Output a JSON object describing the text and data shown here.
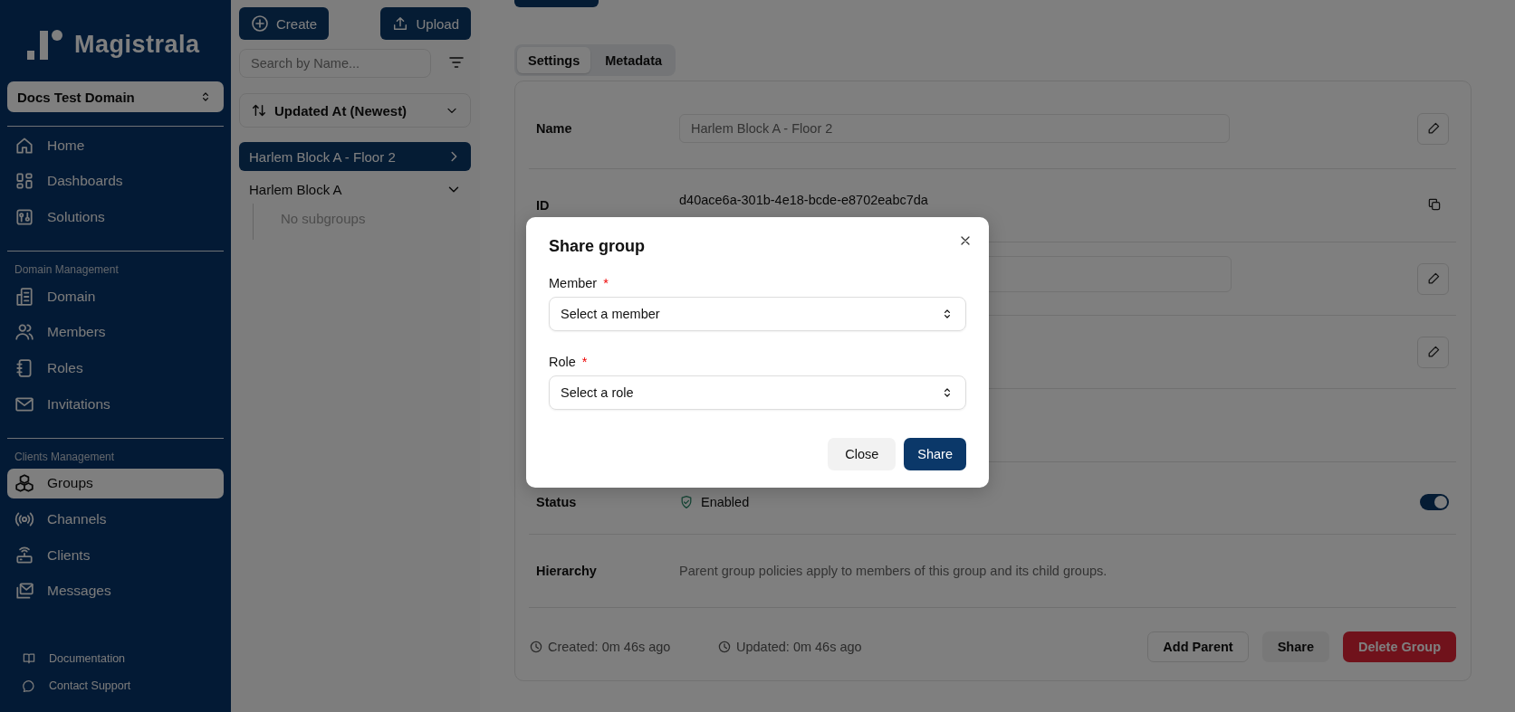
{
  "sidebar": {
    "logo": "Magistrala",
    "domain_selector": "Docs Test Domain",
    "sections": [
      {
        "items": [
          {
            "label": "Home",
            "selected": false
          },
          {
            "label": "Dashboards",
            "selected": false
          },
          {
            "label": "Solutions",
            "selected": false
          }
        ]
      },
      {
        "heading": "Domain Management",
        "items": [
          {
            "label": "Domain",
            "selected": false
          },
          {
            "label": "Members",
            "selected": false
          },
          {
            "label": "Roles",
            "selected": false
          },
          {
            "label": "Invitations",
            "selected": false
          }
        ]
      },
      {
        "heading": "Clients Management",
        "items": [
          {
            "label": "Groups",
            "selected": true
          },
          {
            "label": "Channels",
            "selected": false
          },
          {
            "label": "Clients",
            "selected": false
          },
          {
            "label": "Messages",
            "selected": false
          }
        ]
      }
    ],
    "footer_links": [
      "Documentation",
      "Contact Support"
    ]
  },
  "group_panel": {
    "buttons": [
      "Create",
      "Upload"
    ],
    "search": {
      "placeholder": "Search by Name..."
    },
    "sort": "Updated At (Newest)",
    "groups": [
      {
        "label": "Harlem Block A - Floor 2",
        "selected": true,
        "expanded": false
      },
      {
        "label": "Harlem Block A",
        "selected": false,
        "expanded": true,
        "empty_text": "No subgroups"
      }
    ]
  },
  "details": {
    "tabs": [
      {
        "label": "Settings",
        "selected": true
      },
      {
        "label": "Metadata",
        "selected": false
      }
    ],
    "fields": [
      {
        "kind": "input",
        "label": "Name",
        "value": "Harlem Block A - Floor 2"
      },
      {
        "kind": "copy",
        "label": "ID",
        "value": "d40ace6a-301b-4e18-bcde-e8702eabc7da"
      },
      {
        "kind": "textarea"
      },
      {
        "kind": "edit"
      },
      {
        "kind": "empty"
      },
      {
        "kind": "status",
        "label": "Status",
        "value": "Enabled",
        "on": true
      },
      {
        "kind": "text",
        "label": "Hierarchy",
        "value": "Parent group policies apply to members of this group and its child groups."
      }
    ],
    "created": "Created: 0m 46s ago",
    "updated": "Updated: 0m 46s ago",
    "actions": [
      {
        "label": "Add Parent",
        "kind": "outline"
      },
      {
        "label": "Share",
        "kind": "secondary"
      },
      {
        "label": "Delete Group",
        "kind": "danger"
      }
    ]
  },
  "dialog": {
    "title": "Share group",
    "fields": [
      {
        "label": "Member",
        "required_mark": "*",
        "placeholder": "Select a member"
      },
      {
        "label": "Role",
        "required_mark": "*",
        "placeholder": "Select a role"
      }
    ],
    "buttons": [
      {
        "label": "Close",
        "kind": "secondary"
      },
      {
        "label": "Share",
        "kind": "primary"
      }
    ]
  }
}
